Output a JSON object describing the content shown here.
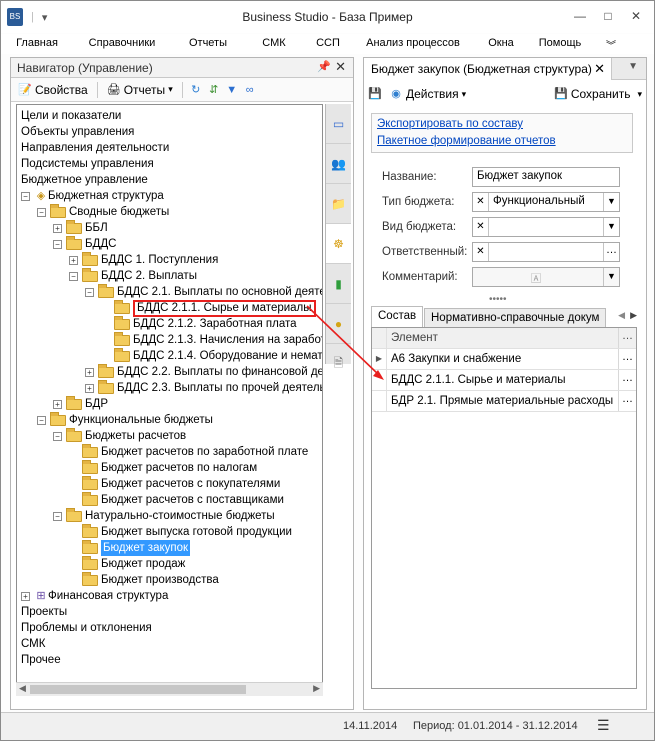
{
  "window": {
    "title": "Business Studio - База Пример",
    "buttons": {
      "minimize": "—",
      "maximize": "□",
      "close": "✕"
    }
  },
  "menu": [
    "Главная",
    "Справочники",
    "Отчеты",
    "СМК",
    "ССП",
    "Анализ процессов",
    "Окна",
    "Помощь"
  ],
  "navigator": {
    "title": "Навигатор (Управление)",
    "toolbar": {
      "properties": "Свойства",
      "reports": "Отчеты"
    },
    "tree": [
      {
        "label": "Цели и показатели",
        "level": 0,
        "icon": "none",
        "toggle": ""
      },
      {
        "label": "Объекты управления",
        "level": 0,
        "icon": "none",
        "toggle": ""
      },
      {
        "label": "Направления деятельности",
        "level": 0,
        "icon": "none",
        "toggle": ""
      },
      {
        "label": "Подсистемы управления",
        "level": 0,
        "icon": "none",
        "toggle": ""
      },
      {
        "label": "Бюджетное управление",
        "level": 0,
        "icon": "none",
        "toggle": ""
      },
      {
        "label": "Бюджетная структура",
        "level": 0,
        "icon": "budget",
        "toggle": "−"
      },
      {
        "label": "Сводные бюджеты",
        "level": 1,
        "icon": "folder",
        "toggle": "−"
      },
      {
        "label": "ББЛ",
        "level": 2,
        "icon": "folder",
        "toggle": "+"
      },
      {
        "label": "БДДС",
        "level": 2,
        "icon": "folder",
        "toggle": "−"
      },
      {
        "label": "БДДС 1. Поступления",
        "level": 3,
        "icon": "folder",
        "toggle": "+"
      },
      {
        "label": "БДДС 2. Выплаты",
        "level": 3,
        "icon": "folder",
        "toggle": "−"
      },
      {
        "label": "БДДС 2.1. Выплаты по основной деятел",
        "level": 4,
        "icon": "folder",
        "toggle": "−"
      },
      {
        "label": "БДДС 2.1.1. Сырье и материалы",
        "level": 5,
        "icon": "folder",
        "toggle": "",
        "boxed": true
      },
      {
        "label": "БДДС 2.1.2. Заработная плата",
        "level": 5,
        "icon": "folder",
        "toggle": ""
      },
      {
        "label": "БДДС 2.1.3. Начисления на заработ",
        "level": 5,
        "icon": "folder",
        "toggle": ""
      },
      {
        "label": "БДДС 2.1.4. Оборудование и немате",
        "level": 5,
        "icon": "folder",
        "toggle": ""
      },
      {
        "label": "БДДС 2.2. Выплаты по финансовой дея",
        "level": 4,
        "icon": "folder",
        "toggle": "+"
      },
      {
        "label": "БДДС 2.3. Выплаты по прочей деятельн",
        "level": 4,
        "icon": "folder",
        "toggle": "+"
      },
      {
        "label": "БДР",
        "level": 2,
        "icon": "folder",
        "toggle": "+"
      },
      {
        "label": "Функциональные бюджеты",
        "level": 1,
        "icon": "folder",
        "toggle": "−"
      },
      {
        "label": "Бюджеты расчетов",
        "level": 2,
        "icon": "folder",
        "toggle": "−"
      },
      {
        "label": "Бюджет расчетов по заработной плате",
        "level": 3,
        "icon": "folder",
        "toggle": ""
      },
      {
        "label": "Бюджет расчетов по налогам",
        "level": 3,
        "icon": "folder",
        "toggle": ""
      },
      {
        "label": "Бюджет расчетов с покупателями",
        "level": 3,
        "icon": "folder",
        "toggle": ""
      },
      {
        "label": "Бюджет расчетов с поставщиками",
        "level": 3,
        "icon": "folder",
        "toggle": ""
      },
      {
        "label": "Натурально-стоимостные бюджеты",
        "level": 2,
        "icon": "folder",
        "toggle": "−"
      },
      {
        "label": "Бюджет выпуска готовой продукции",
        "level": 3,
        "icon": "folder",
        "toggle": ""
      },
      {
        "label": "Бюджет закупок",
        "level": 3,
        "icon": "folder",
        "toggle": "",
        "selected": true
      },
      {
        "label": "Бюджет продаж",
        "level": 3,
        "icon": "folder",
        "toggle": ""
      },
      {
        "label": "Бюджет производства",
        "level": 3,
        "icon": "folder",
        "toggle": ""
      },
      {
        "label": "Финансовая структура",
        "level": 0,
        "icon": "structure",
        "toggle": "+"
      },
      {
        "label": "Проекты",
        "level": 0,
        "icon": "none",
        "toggle": ""
      },
      {
        "label": "Проблемы и отклонения",
        "level": 0,
        "icon": "none",
        "toggle": ""
      },
      {
        "label": "СМК",
        "level": 0,
        "icon": "none",
        "toggle": ""
      },
      {
        "label": "Прочее",
        "level": 0,
        "icon": "none",
        "toggle": ""
      }
    ]
  },
  "detail": {
    "tab_title": "Бюджет закупок (Бюджетная структура)",
    "toolbar": {
      "actions": "Действия",
      "save": "Сохранить"
    },
    "links": [
      "Экспортировать по составу",
      "Пакетное формирование отчетов"
    ],
    "fields": {
      "name_label": "Название:",
      "name_value": "Бюджет закупок",
      "type_label": "Тип бюджета:",
      "type_value": "Функциональный",
      "kind_label": "Вид бюджета:",
      "kind_value": "",
      "owner_label": "Ответственный:",
      "owner_value": "",
      "comment_label": "Комментарий:",
      "comment_value": ""
    },
    "subtabs": [
      "Состав",
      "Нормативно-справочные докум"
    ],
    "grid": {
      "header": "Элемент",
      "rows": [
        "А6 Закупки и снабжение",
        "БДДС 2.1.1. Сырье и материалы",
        "БДР 2.1. Прямые материальные расходы"
      ]
    }
  },
  "status": {
    "date": "14.11.2014",
    "period": "Период: 01.01.2014 - 31.12.2014"
  }
}
